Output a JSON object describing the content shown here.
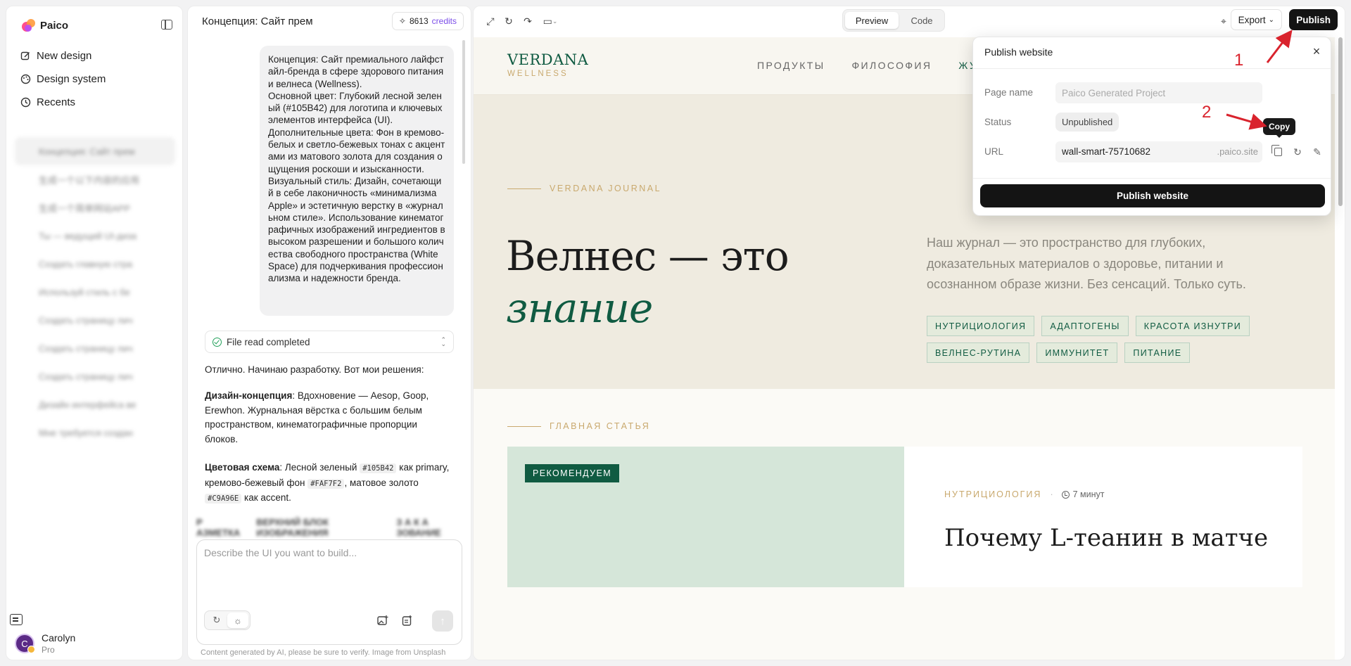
{
  "app": {
    "name": "Paico"
  },
  "sidebar": {
    "nav": [
      {
        "label": "New design",
        "icon": "edit-icon"
      },
      {
        "label": "Design system",
        "icon": "palette-icon"
      },
      {
        "label": "Recents",
        "icon": "history-icon"
      }
    ],
    "recents": [
      "Концепция: Сайт прем",
      "生成一个以下内容的应用",
      "生成一个简单网站APP",
      "Ты — ведущий UI-диза",
      "Создать главную стра",
      "Используй стиль с бе",
      "Создать страницу лич",
      "Создать страницу лич",
      "Создать страницу лич",
      "Дизайн интерфейса ве",
      "Мне требуется создан"
    ],
    "user": {
      "initial": "C",
      "name": "Carolyn",
      "plan": "Pro"
    }
  },
  "chat": {
    "title": "Концепция: Сайт прем",
    "credits_count": "8613",
    "credits_label": "credits",
    "user_message": "Концепция: Сайт премиального лайфстайл-бренда в сфере здорового питания и велнеса (Wellness).\nОсновной цвет: Глубокий лесной зеленый (#105B42) для логотипа и ключевых элементов интерфейса (UI).\nДополнительные цвета: Фон в кремово-белых и светло-бежевых тонах с акцентами из матового золота для создания ощущения роскоши и изысканности.\nВизуальный стиль: Дизайн, сочетающий в себе лаконичность «минимализма Apple» и эстетичную верстку в «журнальном стиле». Использование кинематографичных изображений ингредиентов в высоком разрешении и большого количества свободного пространства (White Space) для подчеркивания профессионализма и надежности бренда.",
    "file_status": "File read completed",
    "reply_intro": "Отлично. Начинаю разработку. Вот мои решения:",
    "concept_label": "Дизайн-концепция",
    "concept_text": ": Вдохновение — Aesop, Goop, Erewhon. Журнальная вёрстка с большим белым пространством, кинематографичные пропорции блоков.",
    "colors_label": "Цветовая схема",
    "colors_p1": ": Лесной зеленый ",
    "colors_code1": "#105B42",
    "colors_p2": " как primary, кремово-бежевый фон ",
    "colors_code2": "#FAF7F2",
    "colors_p3": ", матовое золото ",
    "colors_code3": "#C9A96E",
    "colors_p4": " как accent.",
    "blurred_row": [
      "Р АЗМЕТКА",
      "ВЕРХНИЙ БЛОК ИЗОБРАЖЕНИЯ",
      "З А К А ЗОВАНИЕ"
    ],
    "prompt_placeholder": "Describe the UI you want to build...",
    "disclaimer": "Content  generated by AI, please be sure to verify. Image from Unsplash"
  },
  "toolbar": {
    "preview_label": "Preview",
    "code_label": "Code",
    "export_label": "Export",
    "publish_label": "Publish"
  },
  "site": {
    "brand_name": "VERDANA",
    "brand_sub": "WELLNESS",
    "nav": [
      "ПРОДУКТЫ",
      "ФИЛОСОФИЯ",
      "ЖУ"
    ],
    "hero_eyebrow": "VERDANA JOURNAL",
    "hero_title_line1": "Велнес — это",
    "hero_title_line2": "знание",
    "hero_text": "Наш журнал — это пространство для глубоких, доказательных материалов о здоровье, питании и осознанном образе жизни. Без сенсаций. Только суть.",
    "tags": [
      "НУТРИЦИОЛОГИЯ",
      "АДАПТОГЕНЫ",
      "КРАСОТА ИЗНУТРИ",
      "ВЕЛНЕС-РУТИНА",
      "ИММУНИТЕТ",
      "ПИТАНИЕ"
    ],
    "section_eyebrow": "ГЛАВНАЯ СТАТЬЯ",
    "featured_badge": "РЕКОМЕНДУЕМ",
    "featured_category": "НУТРИЦИОЛОГИЯ",
    "featured_dot": "·",
    "featured_time": "7 минут",
    "featured_title": "Почему L-теанин в матче"
  },
  "publish_dialog": {
    "title": "Publish website",
    "page_name_label": "Page name",
    "page_name_placeholder": "Paico Generated Project",
    "status_label": "Status",
    "status_value": "Unpublished",
    "url_label": "URL",
    "url_value": "wall-smart-75710682",
    "url_domain": ".paico.site",
    "copy_tooltip": "Copy",
    "publish_button": "Publish website"
  },
  "annotations": {
    "step1": "1",
    "step2": "2"
  },
  "colors": {
    "brand_green": "#105B42",
    "cream": "#FAF7F2",
    "gold": "#C9A96E",
    "annotation_red": "#D9232D"
  }
}
